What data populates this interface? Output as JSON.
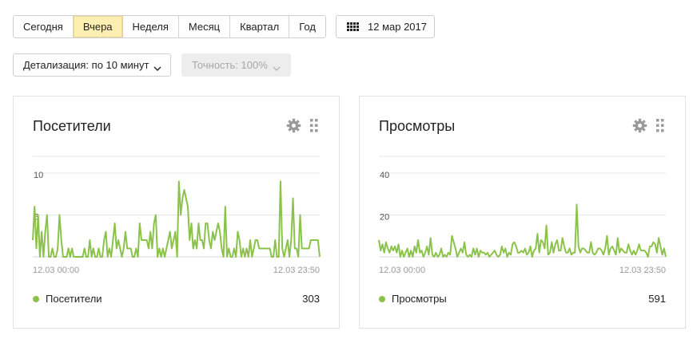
{
  "periods": [
    "Сегодня",
    "Вчера",
    "Неделя",
    "Месяц",
    "Квартал",
    "Год"
  ],
  "active_period": "Вчера",
  "date_button": {
    "label": "12 мар 2017",
    "icon": "calendar-icon"
  },
  "detail_button": {
    "label": "Детализация: по 10 минут",
    "icon": "chevron-down-icon"
  },
  "accuracy_button": {
    "label": "Точность: 100%",
    "icon": "chevron-down-icon"
  },
  "colors": {
    "series": "#8bc34a",
    "active_period_bg": "#fdeeb2",
    "grid": "#e6e6e6"
  },
  "widgets": [
    {
      "title": "Посетители",
      "legend": "Посетители",
      "total": "303",
      "tick_labels": [
        "10",
        "5"
      ],
      "x_start": "12.03 00:00",
      "x_end": "12.03 23:50",
      "chart_data": {
        "type": "line",
        "x_start": "12.03 00:00",
        "x_end": "12.03 23:50",
        "step": "10 min",
        "yticks": [
          5,
          10
        ],
        "ylim": [
          0,
          12
        ],
        "series": [
          {
            "name": "Посетители",
            "values": [
              2,
              6,
              1,
              5,
              0,
              3,
              0,
              3,
              5,
              0,
              0,
              1,
              0,
              0,
              1,
              5,
              2,
              0,
              0,
              0,
              1,
              0,
              1,
              0,
              0,
              0,
              0,
              0,
              0,
              1,
              0,
              0,
              2,
              0,
              1,
              0,
              0,
              1,
              0,
              0,
              2,
              3,
              0,
              1,
              0,
              2,
              4,
              1,
              2,
              1,
              0,
              1,
              3,
              1,
              1,
              1,
              0,
              0,
              1,
              0,
              4,
              2,
              2,
              2,
              2,
              1,
              3,
              1,
              4,
              5,
              0,
              1,
              0,
              1,
              0,
              1,
              2,
              3,
              1,
              2,
              3,
              0,
              9,
              5,
              7,
              8,
              7,
              6,
              2,
              4,
              1,
              2,
              1,
              4,
              2,
              2,
              1,
              4,
              4,
              2,
              1,
              3,
              2,
              3,
              4,
              3,
              1,
              0,
              6,
              0,
              1,
              0,
              0,
              1,
              0,
              3,
              2,
              0,
              1,
              0,
              1,
              0,
              2,
              0,
              1,
              2,
              2,
              1,
              1,
              1,
              1,
              1,
              1,
              1,
              0,
              0,
              2,
              0,
              0,
              9,
              1,
              0,
              1,
              2,
              0,
              2,
              7,
              1,
              1,
              0,
              5,
              1,
              1,
              1,
              1,
              1,
              2,
              2,
              2,
              2,
              2,
              0
            ]
          }
        ]
      }
    },
    {
      "title": "Просмотры",
      "legend": "Просмотры",
      "total": "591",
      "tick_labels": [
        "40",
        "20"
      ],
      "x_start": "12.03 00:00",
      "x_end": "12.03 23:50",
      "chart_data": {
        "type": "line",
        "x_start": "12.03 00:00",
        "x_end": "12.03 23:50",
        "step": "10 min",
        "yticks": [
          20,
          40
        ],
        "ylim": [
          0,
          48
        ],
        "series": [
          {
            "name": "Просмотры",
            "values": [
              8,
              3,
              6,
              2,
              7,
              4,
              2,
              5,
              3,
              5,
              2,
              6,
              0,
              3,
              0,
              2,
              4,
              0,
              3,
              0,
              5,
              2,
              8,
              2,
              3,
              0,
              2,
              5,
              1,
              9,
              1,
              0,
              2,
              0,
              1,
              4,
              0,
              1,
              0,
              2,
              1,
              10,
              7,
              4,
              0,
              2,
              4,
              2,
              7,
              1,
              0,
              1,
              0,
              4,
              1,
              4,
              0,
              3,
              2,
              2,
              1,
              2,
              0,
              1,
              2,
              3,
              1,
              0,
              1,
              5,
              2,
              4,
              0,
              2,
              1,
              6,
              7,
              5,
              2,
              2,
              3,
              2,
              4,
              1,
              2,
              5,
              0,
              3,
              4,
              11,
              2,
              8,
              7,
              4,
              15,
              1,
              2,
              7,
              2,
              6,
              8,
              3,
              3,
              9,
              5,
              2,
              2,
              4,
              1,
              2,
              2,
              25,
              5,
              2,
              4,
              4,
              3,
              2,
              2,
              7,
              2,
              1,
              2,
              4,
              4,
              3,
              1,
              4,
              10,
              1,
              4,
              5,
              3,
              1,
              9,
              2,
              4,
              3,
              2,
              2,
              6,
              3,
              1,
              3,
              1,
              3,
              6,
              3,
              3,
              3,
              2,
              0,
              5,
              5,
              7,
              6,
              2,
              9,
              5,
              1,
              4,
              0
            ]
          }
        ]
      }
    }
  ]
}
